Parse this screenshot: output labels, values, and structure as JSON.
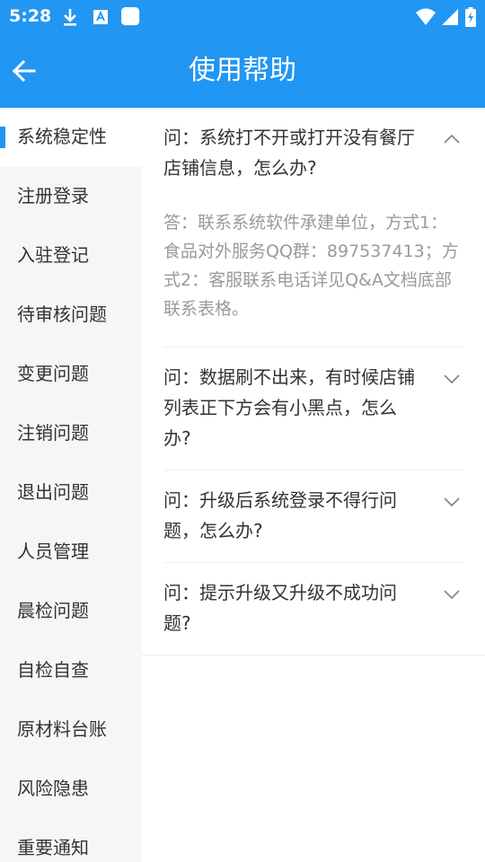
{
  "status_bar": {
    "time": "5:28"
  },
  "header": {
    "title": "使用帮助"
  },
  "sidebar": {
    "items": [
      {
        "label": "系统稳定性"
      },
      {
        "label": "注册登录"
      },
      {
        "label": "入驻登记"
      },
      {
        "label": "待审核问题"
      },
      {
        "label": "变更问题"
      },
      {
        "label": "注销问题"
      },
      {
        "label": "退出问题"
      },
      {
        "label": "人员管理"
      },
      {
        "label": "晨检问题"
      },
      {
        "label": "自检自查"
      },
      {
        "label": "原材料台账"
      },
      {
        "label": "风险隐患"
      },
      {
        "label": "重要通知"
      }
    ],
    "active_index": 0
  },
  "faq": [
    {
      "question": "问：系统打不开或打开没有餐厅店铺信息，怎么办?",
      "answer": "答：联系系统软件承建单位，方式1：食品对外服务QQ群：897537413；方式2：客服联系电话详见Q&A文档底部联系表格。",
      "expanded": true
    },
    {
      "question": "问：数据刷不出来，有时候店铺列表正下方会有小黑点，怎么办?",
      "expanded": false
    },
    {
      "question": "问：升级后系统登录不得行问题，怎么办?",
      "expanded": false
    },
    {
      "question": "问：提示升级又升级不成功问题?",
      "expanded": false
    }
  ],
  "colors": {
    "primary": "#2196F3",
    "sidebar_bg": "#f5f6f8",
    "answer_text": "#9a9a9a"
  },
  "icons": [
    "download-icon",
    "font-icon",
    "app-icon",
    "wifi-icon",
    "signal-icon",
    "battery-icon",
    "arrow-left-icon",
    "chevron-up-icon",
    "chevron-down-icon"
  ]
}
